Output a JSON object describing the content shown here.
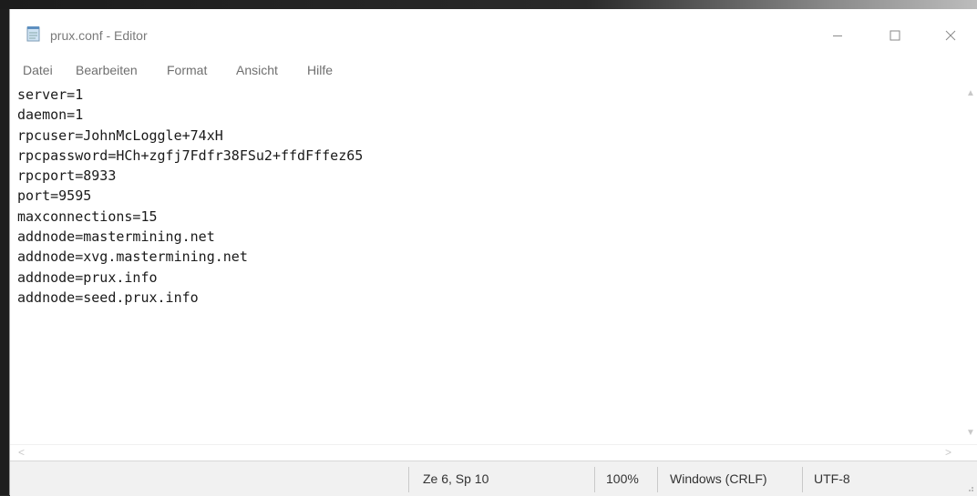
{
  "window": {
    "title": "prux.conf - Editor"
  },
  "menubar": {
    "items": [
      "Datei",
      "Bearbeiten",
      "Format",
      "Ansicht",
      "Hilfe"
    ]
  },
  "editor": {
    "lines": [
      "server=1",
      "daemon=1",
      "rpcuser=JohnMcLoggle+74xH",
      "rpcpassword=HCh+zgfj7Fdfr38FSu2+ffdFffez65",
      "rpcport=8933",
      "port=9595",
      "maxconnections=15",
      "addnode=mastermining.net",
      "addnode=xvg.mastermining.net",
      "addnode=prux.info",
      "addnode=seed.prux.info"
    ]
  },
  "statusbar": {
    "position": "Ze 6, Sp 10",
    "zoom": "100%",
    "line_ending": "Windows (CRLF)",
    "encoding": "UTF-8"
  },
  "icons": {
    "app": "notepad-icon",
    "minimize": "minimize-icon",
    "maximize": "maximize-icon",
    "close": "close-icon"
  }
}
